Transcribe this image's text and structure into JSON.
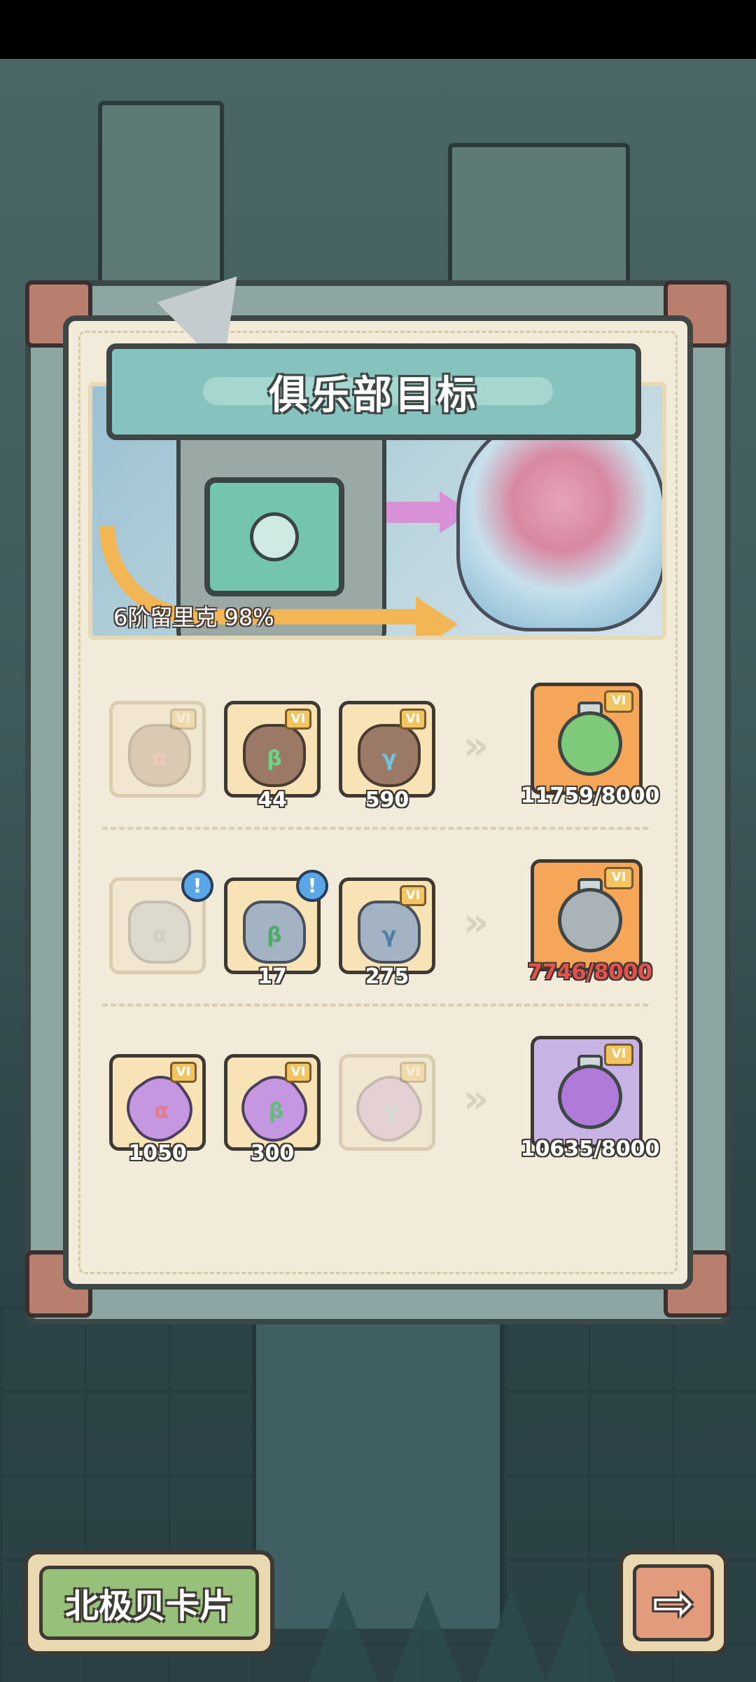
{
  "panel": {
    "title": "俱乐部目标",
    "banner_caption": "6阶留里克 98%"
  },
  "rows": [
    {
      "inputs": [
        {
          "kind": "bag",
          "greek": "α",
          "count": "",
          "dim": true,
          "alert": false
        },
        {
          "kind": "bag",
          "greek": "β",
          "count": "44",
          "dim": false,
          "alert": false
        },
        {
          "kind": "bag",
          "greek": "γ",
          "count": "590",
          "dim": false,
          "alert": false
        }
      ],
      "result": {
        "color": "orange",
        "progress": "11759/8000",
        "over_target": true
      }
    },
    {
      "inputs": [
        {
          "kind": "stone",
          "greek": "α",
          "count": "",
          "dim": true,
          "alert": true
        },
        {
          "kind": "stone",
          "greek": "β",
          "count": "17",
          "dim": false,
          "alert": true
        },
        {
          "kind": "stone",
          "greek": "γ",
          "count": "275",
          "dim": false,
          "alert": false
        }
      ],
      "result": {
        "color": "orange",
        "progress": "7746/8000",
        "over_target": false
      }
    },
    {
      "inputs": [
        {
          "kind": "tube",
          "greek": "α",
          "count": "1050",
          "dim": false,
          "alert": false
        },
        {
          "kind": "tube",
          "greek": "β",
          "count": "300",
          "dim": false,
          "alert": false
        },
        {
          "kind": "tube",
          "greek": "γ",
          "count": "",
          "dim": true,
          "alert": false
        }
      ],
      "result": {
        "color": "purple",
        "progress": "10635/8000",
        "over_target": true
      }
    }
  ],
  "labels": {
    "tier_badge": "VI",
    "alert_mark": "!",
    "chevrons": "»"
  },
  "buttons": {
    "card_label": "北极贝卡片",
    "next_icon": "right-arrow-icon",
    "next_glyph": "⇨"
  },
  "colors": {
    "panel_bg": "#f3ebda",
    "title_plate": "#86c3be",
    "result_orange": "#f6a659",
    "result_purple": "#c7b4e4",
    "shortfall_red": "#e8504d",
    "green_button": "#97c07a"
  }
}
